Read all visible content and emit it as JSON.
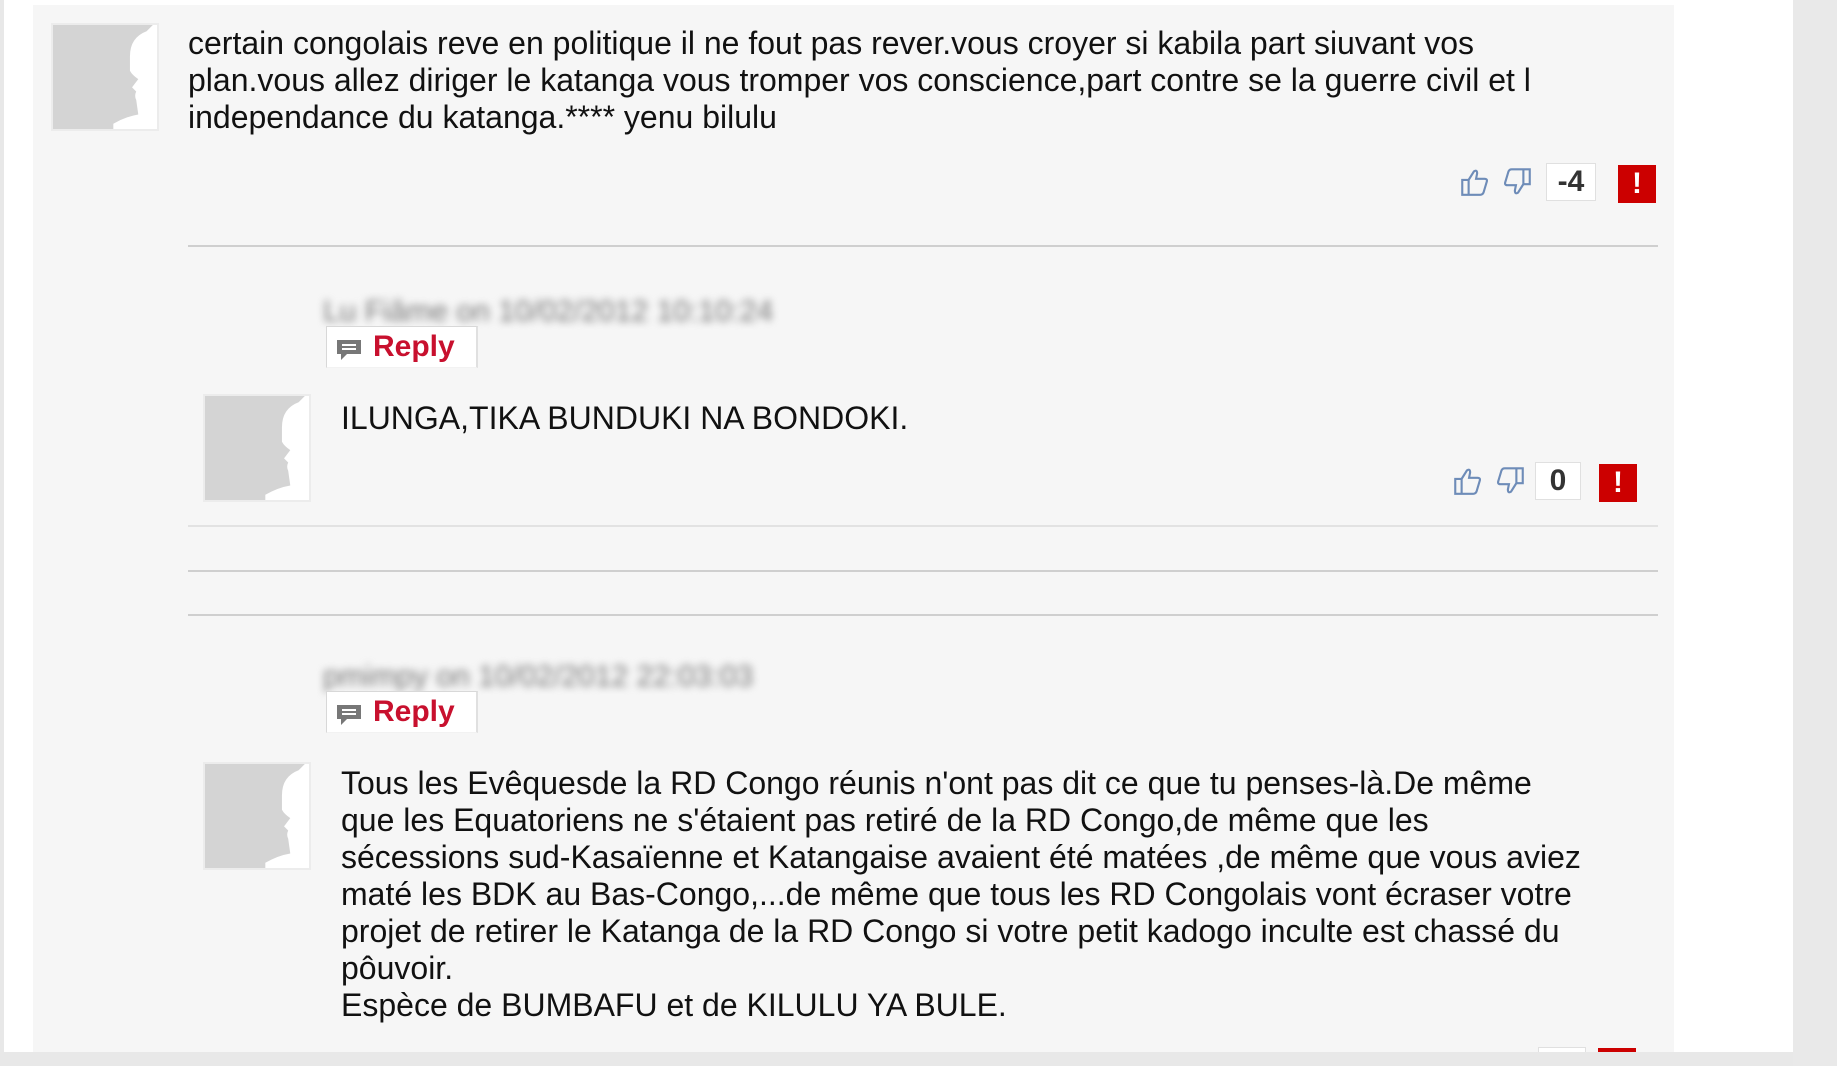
{
  "colors": {
    "accent": "#c8102e",
    "flag": "#cc0000",
    "panel_bg": "#f6f6f6",
    "thumb_blue": "#6e8cb8"
  },
  "comments": [
    {
      "text": "certain congolais reve en politique il ne fout pas rever.vous croyer si kabila part siuvant vos\nplan.vous allez diriger le katanga vous tromper vos conscience,part contre se la guerre civil et l\nindependance du katanga.**** yenu bilulu",
      "score": "-4",
      "flag": "!"
    },
    {
      "meta": "Lu Fiâme on 10/02/2012 10:10:24",
      "reply_label": "Reply",
      "text": "ILUNGA,TIKA BUNDUKI NA BONDOKI.",
      "score": "0",
      "flag": "!"
    },
    {
      "meta": "pmimpy on 10/02/2012 22:03:03",
      "reply_label": "Reply",
      "text": "Tous les Evêquesde la RD Congo réunis n'ont pas dit ce que tu penses-là.De même\nque les Equatoriens ne s'étaient pas retiré de la RD Congo,de même que les\nsécessions sud-Kasaïenne et Katangaise avaient été matées ,de même que vous aviez\nmaté les BDK au Bas-Congo,...de même que tous les RD Congolais vont écraser votre\nprojet de retirer le Katanga de la RD Congo si votre petit kadogo inculte est chassé du\npôuvoir.\nEspèce de BUMBAFU et de KILULU YA BULE."
    }
  ],
  "icons": {
    "avatar": "silhouette-avatar-icon",
    "thumbs_up": "thumbs-up-icon",
    "thumbs_down": "thumbs-down-icon",
    "reply": "speech-bubble-icon"
  }
}
